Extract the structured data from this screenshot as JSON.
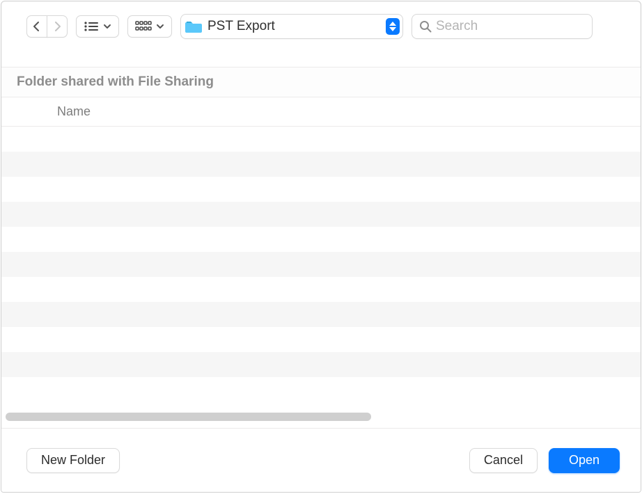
{
  "toolbar": {
    "location_label": "PST Export"
  },
  "search": {
    "placeholder": "Search"
  },
  "info_label": "Folder shared with File Sharing",
  "list": {
    "column_name": "Name",
    "rows": [
      "",
      "",
      "",
      "",
      "",
      "",
      "",
      "",
      "",
      "",
      ""
    ]
  },
  "footer": {
    "new_folder": "New Folder",
    "cancel": "Cancel",
    "open": "Open"
  }
}
